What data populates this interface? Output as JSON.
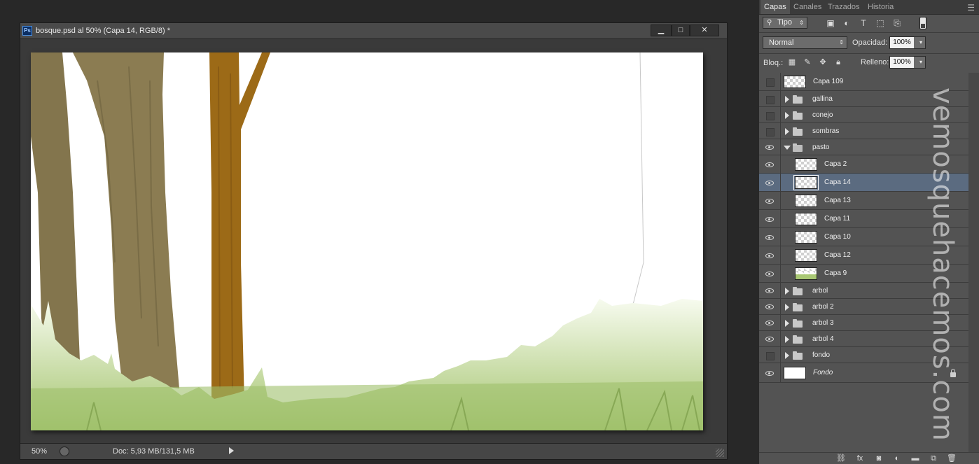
{
  "document": {
    "app_icon": "Ps",
    "title": "bosque.psd al 50% (Capa 14, RGB/8) *",
    "zoom": "50%",
    "doc_info": "Doc: 5,93 MB/131,5 MB",
    "buttons": {
      "minimize": "▁",
      "maximize": "□",
      "close": "✕"
    }
  },
  "panel": {
    "tabs": [
      "Capas",
      "Canales",
      "Trazados",
      "Historia"
    ],
    "active_tab": "Capas",
    "filter_kind": "Tipo",
    "blend_mode": "Normal",
    "opacity_label": "Opacidad:",
    "opacity_value": "100%",
    "lock_label": "Bloq.:",
    "fill_label": "Relleno:",
    "fill_value": "100%",
    "layers": [
      {
        "name": "Capa 109",
        "visible": false
      },
      {
        "name": "gallina",
        "visible": false,
        "group": true
      },
      {
        "name": "conejo",
        "visible": false,
        "group": true
      },
      {
        "name": "sombras",
        "visible": false,
        "group": true
      },
      {
        "name": "pasto",
        "visible": true,
        "group": true,
        "expanded": true
      },
      {
        "name": "Capa 2",
        "visible": true
      },
      {
        "name": "Capa 14",
        "visible": true,
        "selected": true
      },
      {
        "name": "Capa 13",
        "visible": true
      },
      {
        "name": "Capa 11",
        "visible": true
      },
      {
        "name": "Capa 10",
        "visible": true
      },
      {
        "name": "Capa 12",
        "visible": true
      },
      {
        "name": "Capa 9",
        "visible": true
      },
      {
        "name": "arbol",
        "visible": true,
        "group": true
      },
      {
        "name": "arbol 2",
        "visible": true,
        "group": true
      },
      {
        "name": "arbol 3",
        "visible": true,
        "group": true
      },
      {
        "name": "arbol 4",
        "visible": true,
        "group": true
      },
      {
        "name": "fondo",
        "visible": false,
        "group": true
      },
      {
        "name": "Fondo",
        "visible": true,
        "locked": true
      }
    ]
  },
  "watermark": "vemosquehacemos.com",
  "colors": {
    "selection": "#5b6b80",
    "panel": "#535353",
    "grass": "#a9c874",
    "trunk": "#8a7c50",
    "trunk_orange": "#9c6a17"
  }
}
